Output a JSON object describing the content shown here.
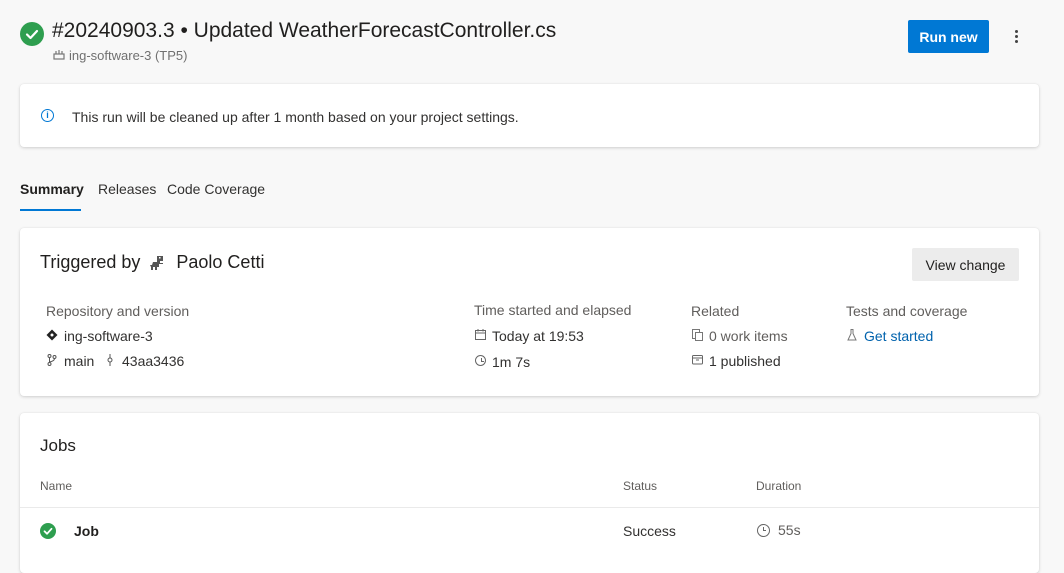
{
  "header": {
    "title": "#20240903.3 • Updated WeatherForecastController.cs",
    "project": "ing-software-3 (TP5)",
    "run_new_label": "Run new",
    "more_label": "⋮"
  },
  "banner": {
    "info_glyph": "i",
    "text": "This run will be cleaned up after 1 month based on your project settings."
  },
  "tabs": [
    {
      "label": "Summary",
      "active": true
    },
    {
      "label": "Releases",
      "active": false
    },
    {
      "label": "Code Coverage",
      "active": false
    }
  ],
  "summary": {
    "triggered_prefix": "Triggered by",
    "triggered_user": "Paolo Cetti",
    "view_change_label": "View change",
    "repo": {
      "heading": "Repository and version",
      "name": "ing-software-3",
      "branch": "main",
      "commit": "43aa3436"
    },
    "time": {
      "heading": "Time started and elapsed",
      "started": "Today at 19:53",
      "elapsed": "1m 7s"
    },
    "related": {
      "heading": "Related",
      "work_items": "0 work items",
      "published": "1 published"
    },
    "tests": {
      "heading": "Tests and coverage",
      "link": "Get started"
    }
  },
  "jobs": {
    "title": "Jobs",
    "columns": [
      "Name",
      "Status",
      "Duration"
    ],
    "rows": [
      {
        "name": "Job",
        "status": "Success",
        "duration": "55s"
      }
    ]
  },
  "colors": {
    "accent": "#0078d4",
    "success": "#2e9e4f",
    "background": "#f8f8f8"
  },
  "icons": [
    "success-check-icon",
    "pipeline-icon",
    "info-icon",
    "avatar-icon",
    "repo-icon",
    "branch-icon",
    "commit-icon",
    "calendar-icon",
    "clock-icon",
    "work-item-icon",
    "artifact-icon",
    "flask-icon"
  ]
}
